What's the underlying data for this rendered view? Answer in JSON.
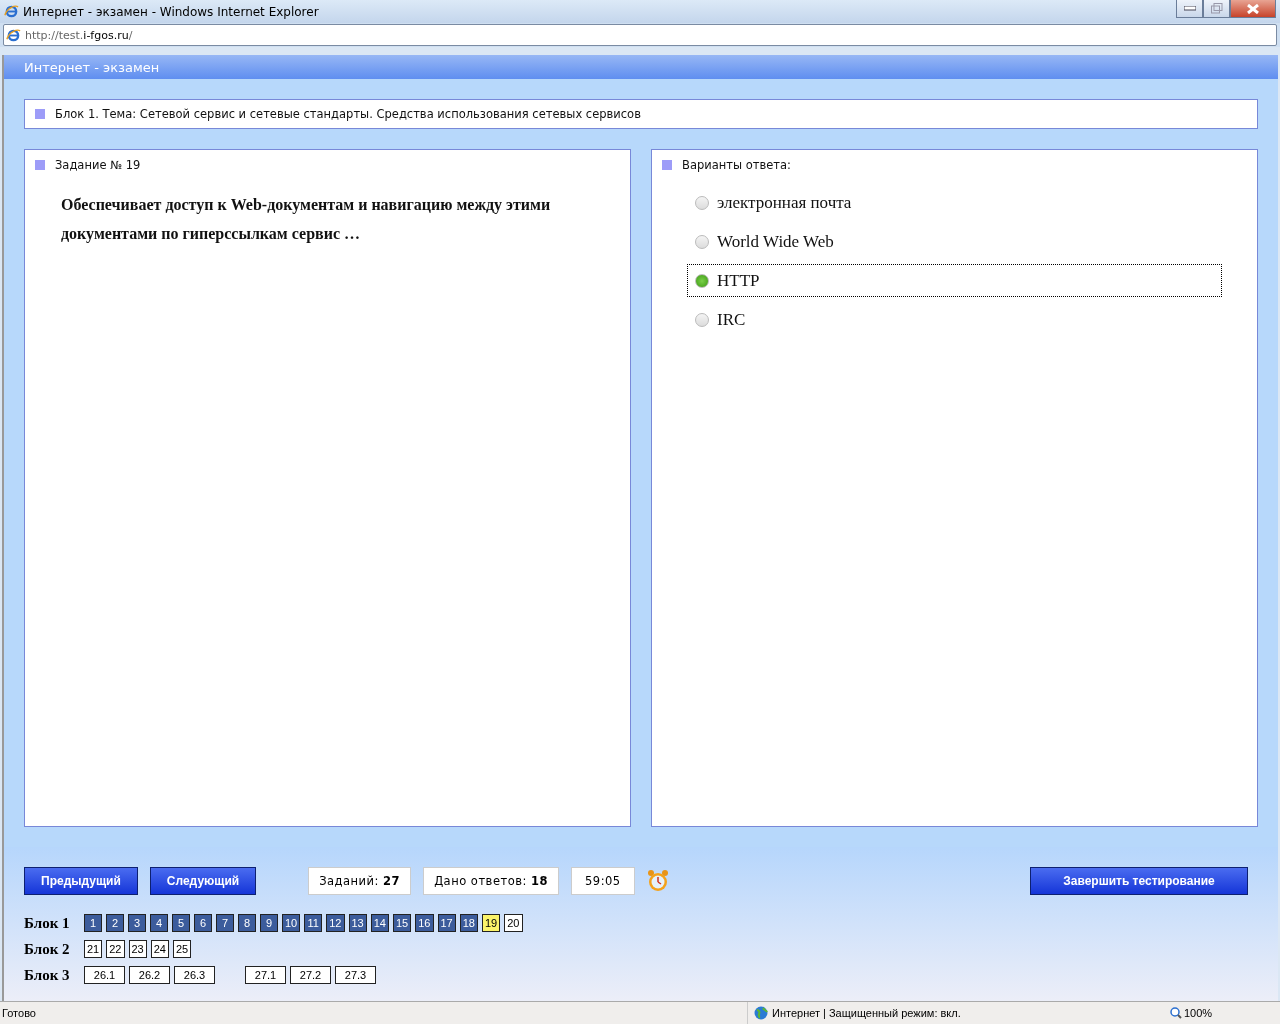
{
  "window": {
    "title": "Интернет - экзамен - Windows Internet Explorer"
  },
  "address_bar": {
    "url_prefix": "http://test.",
    "url_domain": "i-fgos.ru",
    "url_suffix": "/"
  },
  "page_header": {
    "title": "Интернет - экзамен"
  },
  "block_title": "Блок 1. Тема: Сетевой сервис и сетевые стандарты. Средства использования сетевых сервисов",
  "question": {
    "heading": "Задание № 19",
    "text": "Обеспечивает доступ к Web-документам и навигацию между этими документами по гиперссылкам сервис …"
  },
  "answers": {
    "heading": "Варианты ответа:",
    "options": [
      {
        "label": "электронная почта",
        "selected": false
      },
      {
        "label": "World Wide Web",
        "selected": false
      },
      {
        "label": "HTTP",
        "selected": true
      },
      {
        "label": "IRC",
        "selected": false
      }
    ]
  },
  "controls": {
    "prev": "Предыдущий",
    "next": "Следующий",
    "tasks_label": "Заданий:",
    "tasks_value": "27",
    "answered_label": "Дано ответов:",
    "answered_value": "18",
    "timer": "59:05",
    "finish": "Завершить тестирование"
  },
  "blocks": [
    {
      "label": "Блок 1",
      "groups": [
        [
          {
            "label": "1",
            "answered": true,
            "selected": false
          },
          {
            "label": "2",
            "answered": true,
            "selected": false
          },
          {
            "label": "3",
            "answered": true,
            "selected": false
          },
          {
            "label": "4",
            "answered": true,
            "selected": false
          },
          {
            "label": "5",
            "answered": true,
            "selected": false
          },
          {
            "label": "6",
            "answered": true,
            "selected": false
          },
          {
            "label": "7",
            "answered": true,
            "selected": false
          },
          {
            "label": "8",
            "answered": true,
            "selected": false
          },
          {
            "label": "9",
            "answered": true,
            "selected": false
          },
          {
            "label": "10",
            "answered": true,
            "selected": false
          },
          {
            "label": "11",
            "answered": true,
            "selected": false
          },
          {
            "label": "12",
            "answered": true,
            "selected": false
          },
          {
            "label": "13",
            "answered": true,
            "selected": false
          },
          {
            "label": "14",
            "answered": true,
            "selected": false
          },
          {
            "label": "15",
            "answered": true,
            "selected": false
          },
          {
            "label": "16",
            "answered": true,
            "selected": false
          },
          {
            "label": "17",
            "answered": true,
            "selected": false
          },
          {
            "label": "18",
            "answered": true,
            "selected": false
          },
          {
            "label": "19",
            "answered": false,
            "selected": true
          },
          {
            "label": "20",
            "answered": false,
            "selected": false
          }
        ]
      ]
    },
    {
      "label": "Блок 2",
      "groups": [
        [
          {
            "label": "21",
            "answered": false,
            "selected": false
          },
          {
            "label": "22",
            "answered": false,
            "selected": false
          },
          {
            "label": "23",
            "answered": false,
            "selected": false
          },
          {
            "label": "24",
            "answered": false,
            "selected": false
          },
          {
            "label": "25",
            "answered": false,
            "selected": false
          }
        ]
      ]
    },
    {
      "label": "Блок 3",
      "groups": [
        [
          {
            "label": "26.1",
            "answered": false,
            "selected": false
          },
          {
            "label": "26.2",
            "answered": false,
            "selected": false
          },
          {
            "label": "26.3",
            "answered": false,
            "selected": false
          }
        ],
        [
          {
            "label": "27.1",
            "answered": false,
            "selected": false
          },
          {
            "label": "27.2",
            "answered": false,
            "selected": false
          },
          {
            "label": "27.3",
            "answered": false,
            "selected": false
          }
        ]
      ]
    }
  ],
  "status_bar": {
    "text": "Готово",
    "zone": "Интернет | Защищенный режим: вкл.",
    "zoom": "100%"
  }
}
